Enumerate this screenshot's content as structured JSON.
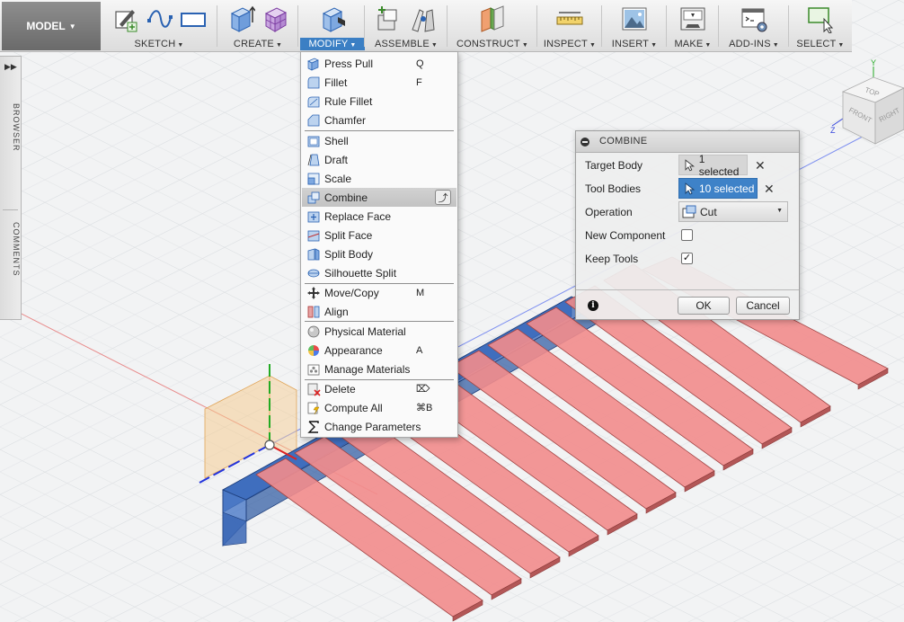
{
  "workspace": {
    "label": "MODEL"
  },
  "toolbar": {
    "groups": [
      {
        "label": "SKETCH"
      },
      {
        "label": "CREATE"
      },
      {
        "label": "MODIFY"
      },
      {
        "label": "ASSEMBLE"
      },
      {
        "label": "CONSTRUCT"
      },
      {
        "label": "INSPECT"
      },
      {
        "label": "INSERT"
      },
      {
        "label": "MAKE"
      },
      {
        "label": "ADD-INS"
      },
      {
        "label": "SELECT"
      }
    ],
    "active_group": "MODIFY",
    "active_color": "#3b7fc4"
  },
  "side_panel": {
    "tabs": [
      "BROWSER",
      "COMMENTS"
    ]
  },
  "modify_menu": {
    "items": [
      {
        "label": "Press Pull",
        "shortcut": "Q",
        "icon": "press-pull-icon"
      },
      {
        "label": "Fillet",
        "shortcut": "F",
        "icon": "fillet-icon"
      },
      {
        "label": "Rule Fillet",
        "shortcut": "",
        "icon": "rule-fillet-icon"
      },
      {
        "label": "Chamfer",
        "shortcut": "",
        "icon": "chamfer-icon"
      },
      {
        "label": "Shell",
        "shortcut": "",
        "icon": "shell-icon"
      },
      {
        "label": "Draft",
        "shortcut": "",
        "icon": "draft-icon"
      },
      {
        "label": "Scale",
        "shortcut": "",
        "icon": "scale-icon"
      },
      {
        "label": "Combine",
        "shortcut": "",
        "icon": "combine-icon"
      },
      {
        "label": "Replace Face",
        "shortcut": "",
        "icon": "replace-face-icon"
      },
      {
        "label": "Split Face",
        "shortcut": "",
        "icon": "split-face-icon"
      },
      {
        "label": "Split Body",
        "shortcut": "",
        "icon": "split-body-icon"
      },
      {
        "label": "Silhouette Split",
        "shortcut": "",
        "icon": "silhouette-split-icon"
      },
      {
        "label": "Move/Copy",
        "shortcut": "M",
        "icon": "move-copy-icon"
      },
      {
        "label": "Align",
        "shortcut": "",
        "icon": "align-icon"
      },
      {
        "label": "Physical Material",
        "shortcut": "",
        "icon": "physical-material-icon"
      },
      {
        "label": "Appearance",
        "shortcut": "A",
        "icon": "appearance-icon"
      },
      {
        "label": "Manage Materials",
        "shortcut": "",
        "icon": "manage-materials-icon"
      },
      {
        "label": "Delete",
        "shortcut": "⌦",
        "icon": "delete-icon"
      },
      {
        "label": "Compute All",
        "shortcut": "⌘B",
        "icon": "compute-all-icon"
      },
      {
        "label": "Change Parameters",
        "shortcut": "",
        "icon": "change-parameters-icon"
      }
    ],
    "highlighted": "Combine"
  },
  "combine_dialog": {
    "title": "COMBINE",
    "target_body": {
      "label": "Target Body",
      "value": "1 selected"
    },
    "tool_bodies": {
      "label": "Tool Bodies",
      "value": "10 selected"
    },
    "operation": {
      "label": "Operation",
      "value": "Cut"
    },
    "new_component": {
      "label": "New Component",
      "checked": false
    },
    "keep_tools": {
      "label": "Keep Tools",
      "checked": true
    },
    "ok_label": "OK",
    "cancel_label": "Cancel"
  },
  "viewcube": {
    "faces": [
      "TOP",
      "FRONT",
      "RIGHT"
    ],
    "axes": [
      "Y",
      "Z"
    ]
  },
  "colors": {
    "target_body": "#3a66b5",
    "tool_bodies": "#f08a8a",
    "selection_blue": "#3e82c8"
  }
}
